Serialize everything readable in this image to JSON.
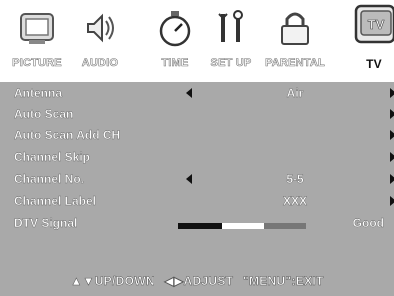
{
  "tabs": [
    {
      "label": "PICTURE",
      "icon": "picture-icon"
    },
    {
      "label": "AUDIO",
      "icon": "audio-icon"
    },
    {
      "label": "TIME",
      "icon": "timer-icon"
    },
    {
      "label": "SET UP",
      "icon": "setup-tools-icon"
    },
    {
      "label": "PARENTAL",
      "icon": "padlock-icon"
    },
    {
      "label": "TV",
      "icon": "tv-icon",
      "active": true
    }
  ],
  "menu": {
    "rows": [
      {
        "label": "Antenna",
        "value": "Air",
        "arrows": true
      },
      {
        "label": "Auto Scan",
        "value": "",
        "arrows": false
      },
      {
        "label": "Auto Scan Add CH",
        "value": "",
        "arrows": false
      },
      {
        "label": "Channel Skip",
        "value": "",
        "arrows": false
      },
      {
        "label": "Channel No.",
        "value": "5-5",
        "arrows": true
      },
      {
        "label": "Channel Label",
        "value": "XXX",
        "arrows": false
      },
      {
        "label": "DTV Signal",
        "value": "Good",
        "arrows": false
      }
    ]
  },
  "signal": {
    "level_fraction": 0.67
  },
  "footer": {
    "updown": "▲▼UP/DOWN",
    "adjust": "◀▶ADJUST",
    "exit": "\"MENU\":EXIT"
  }
}
